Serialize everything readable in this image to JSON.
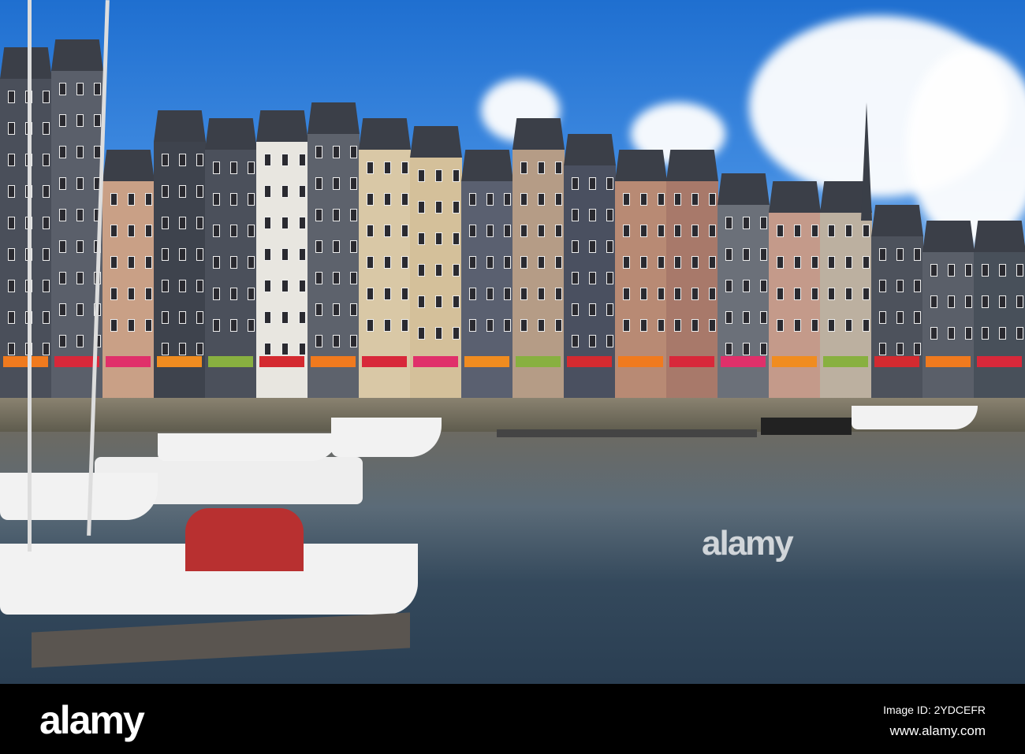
{
  "watermark": "alamy",
  "footer": {
    "logo": "alamy",
    "image_id": "Image ID: 2YDCEFR",
    "url": "www.alamy.com"
  },
  "colors": {
    "sky": "#2f7fd8",
    "water": "#3a4e60",
    "awning": "#f07a1e"
  },
  "building_colors": [
    "#4a4f5a",
    "#5a5f6a",
    "#c9a086",
    "#3e434d",
    "#4b505b",
    "#e8e6e0",
    "#5d626c",
    "#d9c8a6",
    "#d4c09a",
    "#5a6070",
    "#b59c86",
    "#4a5060",
    "#b88a74",
    "#a8796a",
    "#6b7079",
    "#c49a8a",
    "#bcb0a0",
    "#4d525c",
    "#5a5f69",
    "#48505a"
  ],
  "awning_colors": [
    "#f07a1e",
    "#d8283a",
    "#e0306a",
    "#f08c20",
    "#88b040",
    "#d42a30"
  ]
}
